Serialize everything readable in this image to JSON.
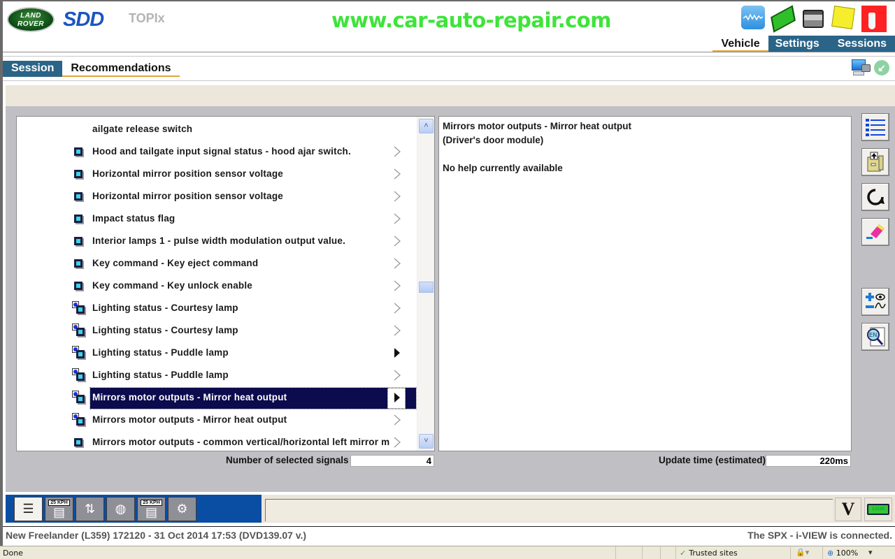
{
  "header": {
    "brand_logo": "LAND ROVER",
    "app_name": "SDD",
    "secondary_app": "TOPIx",
    "watermark": "www.car-auto-repair.com",
    "top_icons": [
      "waveform-icon",
      "green-vehicle-icon",
      "battery-charger-icon",
      "sticky-note-icon",
      "red-vci-icon"
    ],
    "top_tabs": [
      {
        "label": "Vehicle",
        "active": true
      },
      {
        "label": "Settings",
        "active": false
      },
      {
        "label": "Sessions",
        "active": false
      }
    ]
  },
  "sub_tabs": [
    {
      "label": "Session",
      "active": true
    },
    {
      "label": "Recommendations",
      "active": false
    }
  ],
  "signal_list": {
    "rows": [
      {
        "label": "ailgate release switch",
        "icon": "none",
        "arrow": "none",
        "selected": false
      },
      {
        "label": "Hood and tailgate input signal status - hood ajar switch.",
        "icon": "single",
        "arrow": "outline",
        "selected": false
      },
      {
        "label": "Horizontal mirror position sensor voltage",
        "icon": "single",
        "arrow": "outline",
        "selected": false
      },
      {
        "label": "Horizontal mirror position sensor voltage",
        "icon": "single",
        "arrow": "outline",
        "selected": false
      },
      {
        "label": "Impact status flag",
        "icon": "single",
        "arrow": "outline",
        "selected": false
      },
      {
        "label": "Interior lamps 1 - pulse width modulation output value.",
        "icon": "single",
        "arrow": "outline",
        "selected": false
      },
      {
        "label": "Key command  -  Key eject command",
        "icon": "single",
        "arrow": "outline",
        "selected": false
      },
      {
        "label": "Key command  -  Key unlock enable",
        "icon": "single",
        "arrow": "outline",
        "selected": false
      },
      {
        "label": "Lighting status  -  Courtesy lamp",
        "icon": "multi",
        "arrow": "outline",
        "selected": false
      },
      {
        "label": "Lighting status  -  Courtesy lamp",
        "icon": "multi",
        "arrow": "outline",
        "selected": false
      },
      {
        "label": "Lighting status  -  Puddle lamp",
        "icon": "multi",
        "arrow": "filled",
        "selected": false
      },
      {
        "label": "Lighting status  -  Puddle lamp",
        "icon": "multi",
        "arrow": "outline",
        "selected": false
      },
      {
        "label": "Mirrors motor outputs  -  Mirror heat output",
        "icon": "multi",
        "arrow": "filled",
        "selected": true
      },
      {
        "label": "Mirrors motor outputs  -  Mirror heat output",
        "icon": "multi",
        "arrow": "outline",
        "selected": false
      },
      {
        "label": "Mirrors motor outputs - common vertical/horizontal left mirror m",
        "icon": "single",
        "arrow": "outline",
        "selected": false
      }
    ],
    "scroll_position": 0.5
  },
  "help": {
    "title": "Mirrors motor outputs  -  Mirror heat output",
    "module": "(Driver's door module)",
    "message": "No help currently available"
  },
  "counters": {
    "selected_label": "Number of selected signals",
    "selected_value": "4",
    "update_label": "Update time (estimated)",
    "update_value": "220ms"
  },
  "side_tools": [
    "list-icon",
    "save-load-icon",
    "refresh-icon",
    "eraser-icon",
    "add-remove-watch-icon",
    "search-document-icon"
  ],
  "bottom_toolbar": {
    "buttons": [
      {
        "name": "signal-select-icon",
        "text": "",
        "active": true
      },
      {
        "name": "speed-gauge-icon",
        "text": "25 KPH",
        "active": false
      },
      {
        "name": "sort-icon",
        "text": "",
        "active": false
      },
      {
        "name": "network-settings-icon",
        "text": "",
        "active": false
      },
      {
        "name": "speed-graph-icon",
        "text": "25 KPH",
        "active": false
      },
      {
        "name": "recorder-icon",
        "text": "",
        "active": false
      }
    ],
    "voltage_icon": "V",
    "battery_text": "12534"
  },
  "vehicle_status": {
    "vehicle": "New Freelander (L359) 172120 - 31 Oct 2014 17:53 (DVD139.07 v.)",
    "connection": "The SPX - i-VIEW is connected."
  },
  "browser_status": {
    "status": "Done",
    "zone": "Trusted sites",
    "zoom": "100%"
  }
}
